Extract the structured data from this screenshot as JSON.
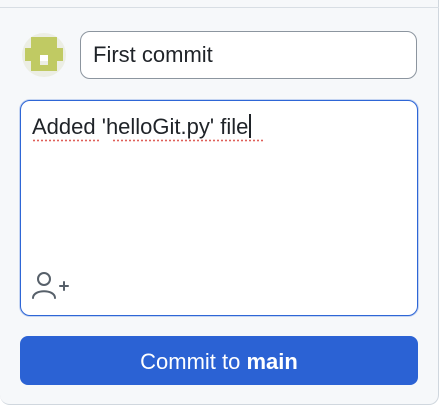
{
  "commit": {
    "summary_value": "First commit",
    "description_value": "Added 'helloGit.py' file",
    "description_parts": {
      "plain_1": "Added '",
      "misspelled": "helloGit.py",
      "plain_2": "' file"
    }
  },
  "button": {
    "label_prefix": "Commit to ",
    "branch": "main"
  },
  "icons": {
    "avatar": "identicon-avatar",
    "coauthor": "add-coauthor-icon"
  },
  "colors": {
    "accent": "#2b62d4",
    "focus_border": "#2e66d6",
    "avatar_fg": "#c0ca63",
    "spellcheck": "#e0605a"
  }
}
